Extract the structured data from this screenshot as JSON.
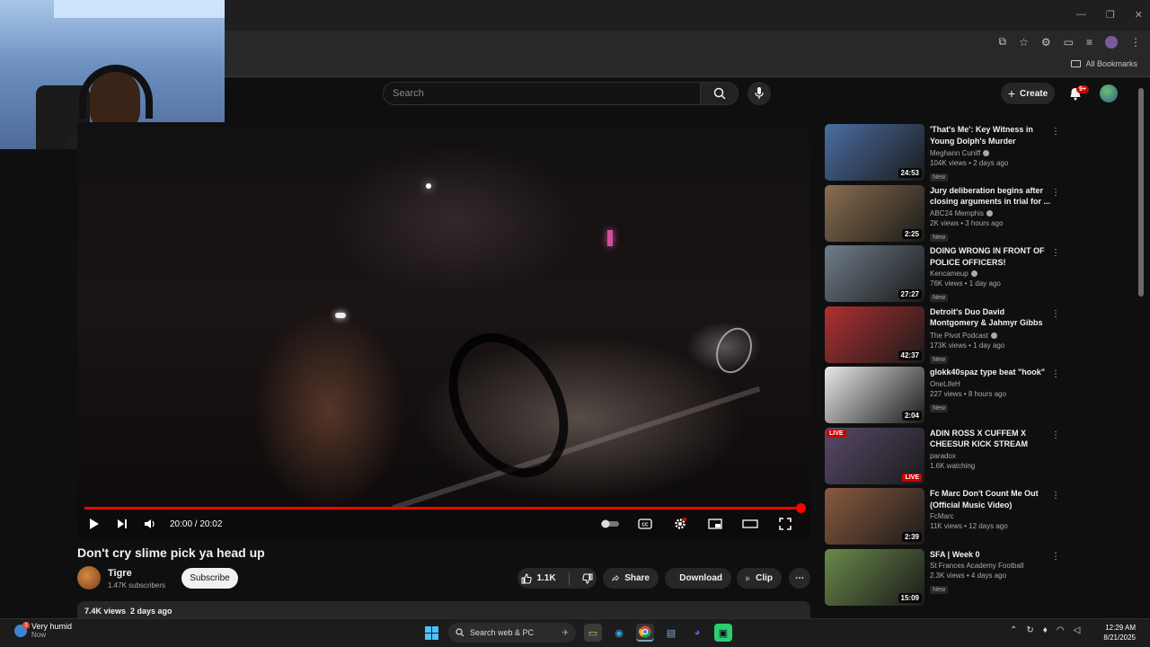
{
  "browser": {
    "window_controls": [
      "—",
      "❐",
      "✕"
    ],
    "all_bookmarks": "All Bookmarks"
  },
  "header": {
    "search_placeholder": "Search",
    "create_label": "Create",
    "notif_count": "9+"
  },
  "player": {
    "time": "20:00 / 20:02",
    "progress_fraction": 0.998
  },
  "video": {
    "title": "Don't cry slime pick ya head up",
    "channel": "Tigre",
    "subscribers": "1.47K subscribers",
    "subscribe_label": "Subscribe",
    "likes": "1.1K",
    "share_label": "Share",
    "download_label": "Download",
    "clip_label": "Clip",
    "description_meta": "7.4K views  2 days ago"
  },
  "recommendations": [
    {
      "title": "'That's Me': Key Witness in Young Dolph's Murder Identifie...",
      "channel": "Meghann Cuniff",
      "verified": true,
      "meta": "104K views • 2 days ago",
      "badge": "New",
      "duration": "24:53",
      "live": false
    },
    {
      "title": "Jury deliberation begins after closing arguments in trial for ...",
      "channel": "ABC24 Memphis",
      "verified": true,
      "meta": "2K views • 3 hours ago",
      "badge": "New",
      "duration": "2:25",
      "live": false
    },
    {
      "title": "DOING WRONG IN FRONT OF POLICE OFFICERS!",
      "channel": "Kencameup",
      "verified": true,
      "meta": "76K views • 1 day ago",
      "badge": "New",
      "duration": "27:27",
      "live": false
    },
    {
      "title": "Detroit's Duo David Montgomery & Jahmyr Gibbs on new offens...",
      "channel": "The Pivot Podcast",
      "verified": true,
      "meta": "173K views • 1 day ago",
      "badge": "New",
      "duration": "42:37",
      "live": false
    },
    {
      "title": "glokk40spaz type beat \"hook\"",
      "channel": "OneLifeH",
      "verified": false,
      "meta": "227 views • 8 hours ago",
      "badge": "New",
      "duration": "2:04",
      "live": false
    },
    {
      "title": "ADIN ROSS X CUFFEM X CHEESUR KICK STREAM",
      "channel": "paradox",
      "verified": false,
      "meta": "1.6K watching",
      "badge": "",
      "duration": "LIVE",
      "live": true
    },
    {
      "title": "Fc Marc Don't Count Me Out (Official Music Video)",
      "channel": "FcMarc",
      "verified": false,
      "meta": "11K views • 12 days ago",
      "badge": "",
      "duration": "2:39",
      "live": false
    },
    {
      "title": "SFA | Week 0",
      "channel": "St Frances Academy Football",
      "verified": false,
      "meta": "2.3K views • 4 days ago",
      "badge": "New",
      "duration": "15:09",
      "live": false
    }
  ],
  "thumb_colors": [
    "#4a6fa5",
    "#8a6e4f",
    "#6f7d8a",
    "#b03030",
    "#e8e8e8",
    "#5a4a6a",
    "#8a5a40",
    "#6a8a4a"
  ],
  "taskbar": {
    "weather_line1": "Very humid",
    "weather_line2": "Now",
    "weather_badge": "1",
    "search_label": "Search web & PC",
    "time": "12:29 AM",
    "date": "8/21/2025"
  },
  "colors": {
    "accent": "#ff0000",
    "background": "#0f0f0f"
  }
}
